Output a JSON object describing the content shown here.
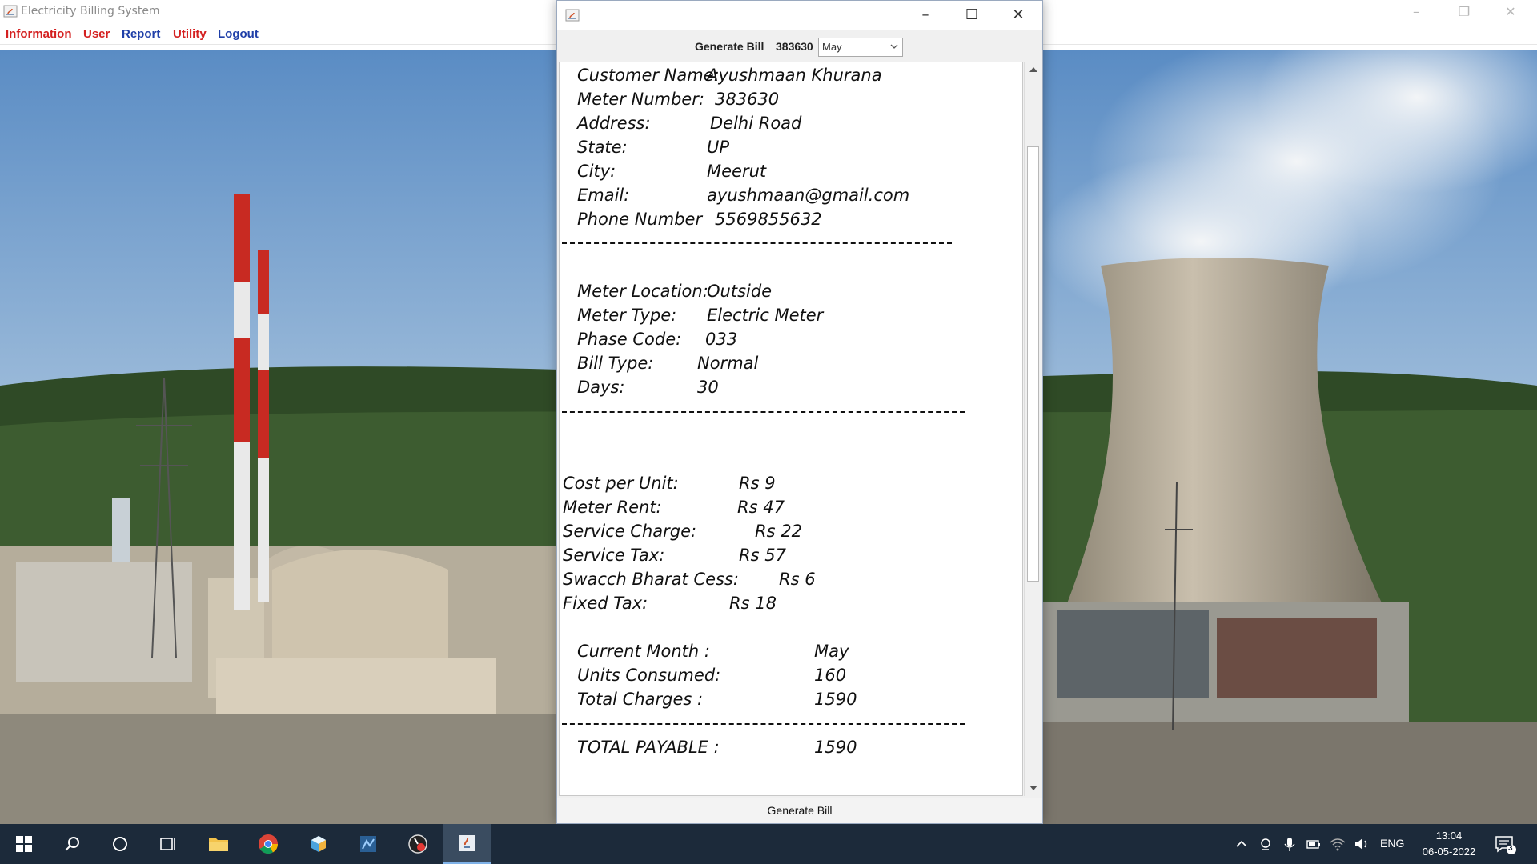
{
  "main_window": {
    "title": "Electricity Billing System",
    "menu": [
      {
        "label": "Information",
        "color": "#d42020"
      },
      {
        "label": "User",
        "color": "#d42020"
      },
      {
        "label": "Report",
        "color": "#1f3fa8"
      },
      {
        "label": "Utility",
        "color": "#d42020"
      },
      {
        "label": "Logout",
        "color": "#1f3fa8"
      }
    ]
  },
  "bill_window": {
    "header_label": "Generate Bill",
    "meter_number": "383630",
    "month_selected": "May",
    "customer": {
      "name_label": "Customer Name:",
      "name": "Ayushmaan Khurana",
      "meter_label": "Meter Number:",
      "meter": "383630",
      "address_label": "Address:",
      "address": "Delhi Road",
      "state_label": "State:",
      "state": "UP",
      "city_label": "City:",
      "city": "Meerut",
      "email_label": "Email:",
      "email": "ayushmaan@gmail.com",
      "phone_label": "Phone Number",
      "phone": "5569855632"
    },
    "meter_info": {
      "location_label": "Meter Location:",
      "location": "Outside",
      "type_label": "Meter Type:",
      "type": "Electric Meter",
      "phase_label": "Phase Code:",
      "phase": "033",
      "bill_type_label": "Bill Type:",
      "bill_type": "Normal",
      "days_label": "Days:",
      "days": "30"
    },
    "tariff": {
      "cost_label": "Cost per Unit:",
      "cost": "Rs 9",
      "rent_label": "Meter Rent:",
      "rent": "Rs 47",
      "service_charge_label": "Service Charge:",
      "service_charge": "Rs 22",
      "service_tax_label": "Service Tax:",
      "service_tax": "Rs 57",
      "cess_label": "Swacch Bharat Cess:",
      "cess": "Rs 6",
      "fixed_tax_label": "Fixed Tax:",
      "fixed_tax": "Rs 18"
    },
    "summary": {
      "month_label": "Current Month :",
      "month": "May",
      "units_label": "Units Consumed:",
      "units": "160",
      "total_label": "Total Charges :",
      "total": "1590",
      "payable_label": "TOTAL PAYABLE :",
      "payable": "1590"
    },
    "generate_button": "Generate Bill"
  },
  "taskbar": {
    "language": "ENG",
    "time": "13:04",
    "date": "06-05-2022",
    "notification_count": "3"
  }
}
